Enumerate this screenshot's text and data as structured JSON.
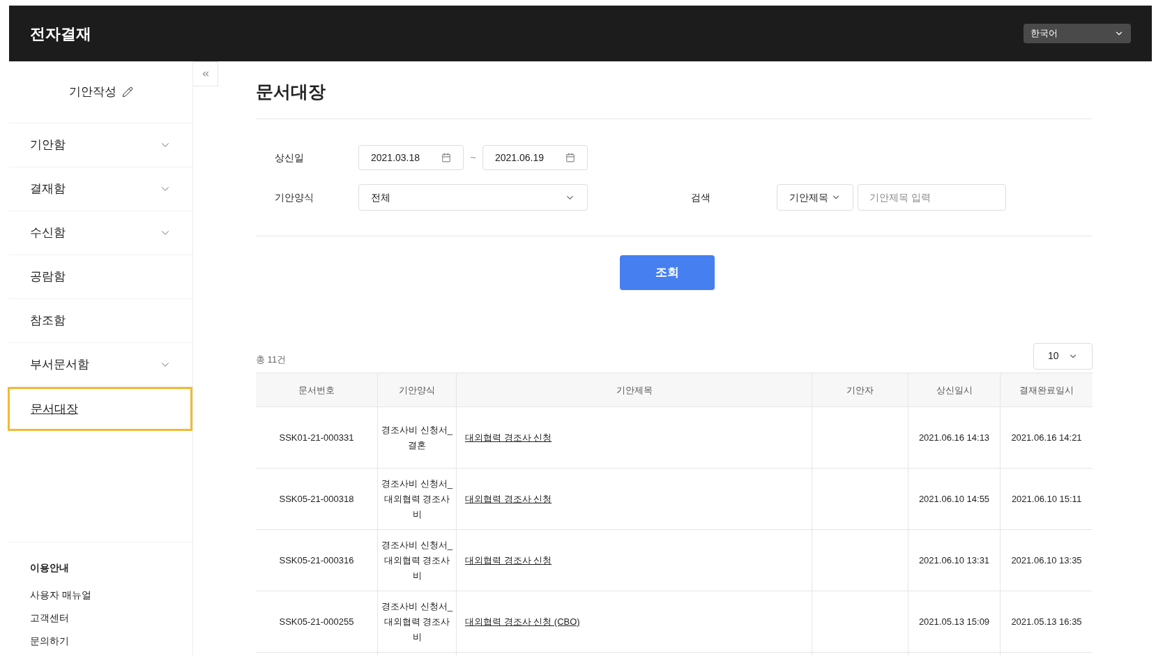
{
  "header": {
    "title": "전자결재",
    "language": "한국어"
  },
  "sidebar": {
    "compose": "기안작성",
    "items": [
      {
        "label": "기안함",
        "expandable": true,
        "selected": false
      },
      {
        "label": "결재함",
        "expandable": true,
        "selected": false
      },
      {
        "label": "수신함",
        "expandable": true,
        "selected": false
      },
      {
        "label": "공람함",
        "expandable": false,
        "selected": false
      },
      {
        "label": "참조함",
        "expandable": false,
        "selected": false
      },
      {
        "label": "부서문서함",
        "expandable": true,
        "selected": false
      },
      {
        "label": "문서대장",
        "expandable": false,
        "selected": true
      }
    ],
    "help": {
      "title": "이용안내",
      "links": [
        "사용자 매뉴얼",
        "고객센터",
        "문의하기"
      ]
    }
  },
  "page": {
    "title": "문서대장",
    "filters": {
      "date_label": "상신일",
      "date_from": "2021.03.18",
      "date_sep": "~",
      "date_to": "2021.06.19",
      "form_label": "기안양식",
      "form_value": "전체",
      "search_label": "검색",
      "search_field": "기안제목",
      "search_placeholder": "기안제목 입력"
    },
    "submit": "조회",
    "total": "총 11건",
    "page_size": "10",
    "table": {
      "columns": [
        "문서번호",
        "기안양식",
        "기안제목",
        "기안자",
        "상신일시",
        "결재완료일시"
      ],
      "rows": [
        {
          "number": "SSK01-21-000331",
          "form": "경조사비 신청서_결혼",
          "title": "대외협력 경조사 신청",
          "drafter": "",
          "submitted": "2021.06.16 14:13",
          "completed": "2021.06.16 14:21"
        },
        {
          "number": "SSK05-21-000318",
          "form": "경조사비 신청서_대외협력 경조사비",
          "title": "대외협력 경조사 신청",
          "drafter": "",
          "submitted": "2021.06.10 14:55",
          "completed": "2021.06.10 15:11"
        },
        {
          "number": "SSK05-21-000316",
          "form": "경조사비 신청서_대외협력 경조사비",
          "title": "대외협력 경조사 신청",
          "drafter": "",
          "submitted": "2021.06.10 13:31",
          "completed": "2021.06.10 13:35"
        },
        {
          "number": "SSK05-21-000255",
          "form": "경조사비 신청서_대외협력 경조사비",
          "title": "대외협력 경조사 신청 (CBO)",
          "drafter": "",
          "submitted": "2021.05.13 15:09",
          "completed": "2021.05.13 16:35"
        }
      ]
    }
  }
}
